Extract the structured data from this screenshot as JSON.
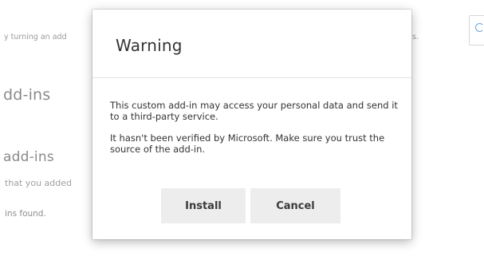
{
  "background": {
    "intro_left": "y turning an add",
    "intro_right": "s.",
    "heading_addins": "dd-ins",
    "heading_my_addins": "add-ins",
    "description": "that you added",
    "empty_state": "ins found.",
    "search_icon": "search-icon"
  },
  "dialog": {
    "title": "Warning",
    "paragraphs": [
      "This custom add-in may access your personal data and send it to a third-party service.",
      "It hasn't been verified by Microsoft. Make sure you trust the source of the add-in."
    ],
    "install_label": "Install",
    "cancel_label": "Cancel"
  },
  "colors": {
    "title": "#333333",
    "button_bg": "#ededed",
    "button_text": "#3a3a3a",
    "faded_text": "#8a8a8a"
  }
}
